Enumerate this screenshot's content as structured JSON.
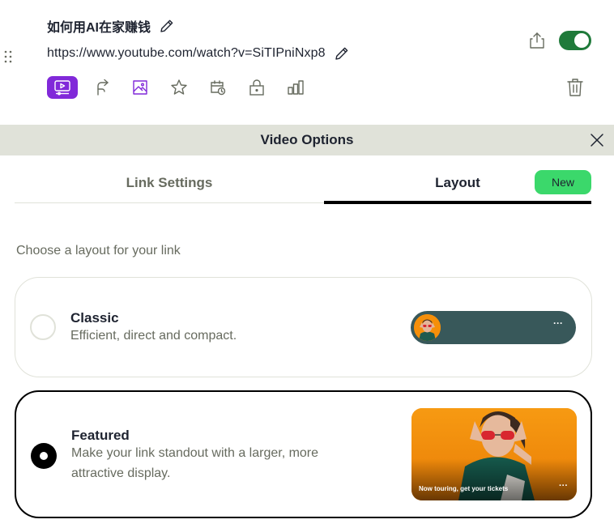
{
  "link": {
    "title": "如何用AI在家赚钱",
    "url": "https://www.youtube.com/watch?v=SiTIPniNxp8",
    "enabled": true
  },
  "toolbar": {
    "tools": [
      {
        "icon": "video-icon",
        "active": true
      },
      {
        "icon": "redirect-icon",
        "active": false
      },
      {
        "icon": "image-icon",
        "active": false
      },
      {
        "icon": "star-icon",
        "active": false
      },
      {
        "icon": "schedule-icon",
        "active": false
      },
      {
        "icon": "lock-icon",
        "active": false
      },
      {
        "icon": "analytics-icon",
        "active": false
      }
    ]
  },
  "options_panel": {
    "title": "Video Options",
    "tabs": [
      {
        "label": "Link Settings",
        "active": false
      },
      {
        "label": "Layout",
        "active": true,
        "badge": "New"
      }
    ],
    "prompt": "Choose a layout for your link",
    "layouts": [
      {
        "name": "Classic",
        "description": "Efficient, direct and compact.",
        "selected": false,
        "preview_dots": "···"
      },
      {
        "name": "Featured",
        "description": "Make your link standout with a larger, more attractive display.",
        "selected": true,
        "preview_caption": "Now touring, get your tickets",
        "preview_dots": "···"
      }
    ]
  },
  "colors": {
    "accent": "#8129d9",
    "toggle_on": "#1f7a3a",
    "badge_green": "#3bd86b",
    "header_bg": "#e0e2d9",
    "classic_preview_bg": "#38585a",
    "featured_preview_bg": "#f5930e"
  }
}
